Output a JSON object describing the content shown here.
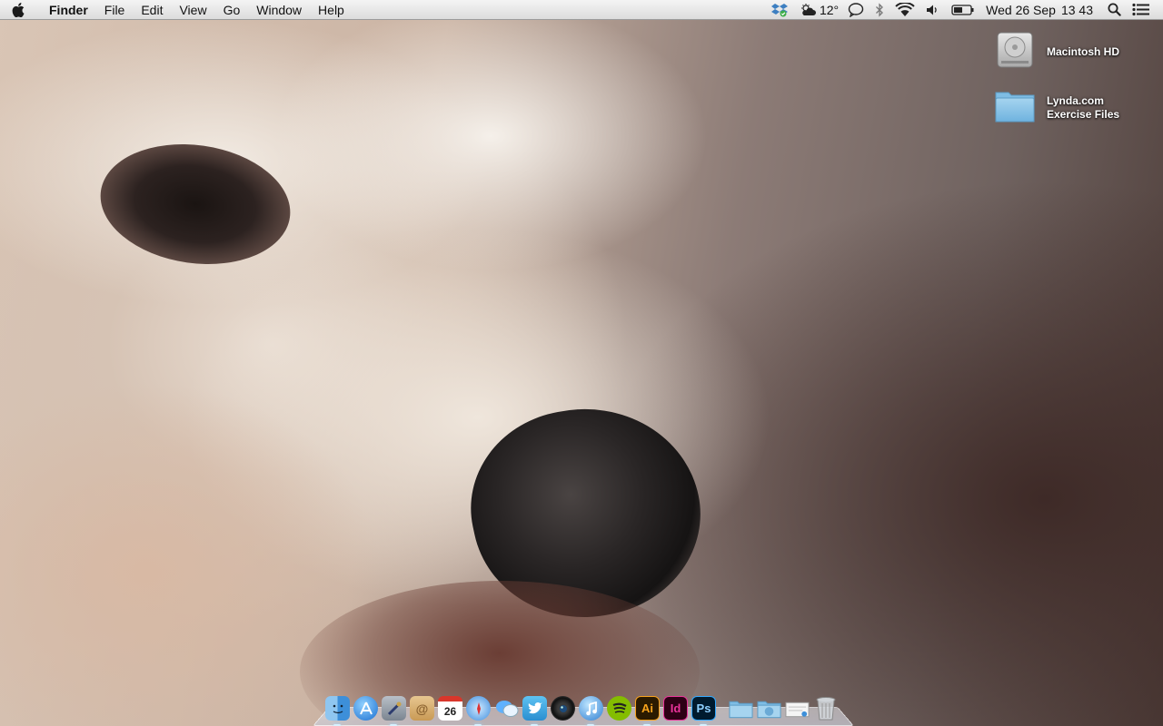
{
  "menubar": {
    "app_name": "Finder",
    "menus": [
      "File",
      "Edit",
      "View",
      "Go",
      "Window",
      "Help"
    ],
    "status": {
      "weather_temp": "12°",
      "date": "Wed 26 Sep",
      "time": "13 43"
    }
  },
  "desktop": {
    "icons": [
      {
        "label": "Macintosh HD",
        "icon": "hard-drive-icon"
      },
      {
        "label": "Lynda.com\nExercise Files",
        "icon": "folder-icon"
      }
    ]
  },
  "dock": {
    "calendar_day": "26",
    "illustrator_label": "Ai",
    "indesign_label": "Id",
    "photoshop_label": "Ps",
    "apps": [
      "finder-icon",
      "app-store-icon",
      "system-preferences-icon",
      "contacts-icon",
      "calendar-icon",
      "safari-icon",
      "messages-icon",
      "twitter-icon",
      "photo-booth-icon",
      "itunes-icon",
      "spotify-icon",
      "illustrator-icon",
      "indesign-icon",
      "photoshop-icon",
      "applications-folder-icon",
      "downloads-folder-icon",
      "mail-document-icon",
      "trash-icon"
    ]
  }
}
